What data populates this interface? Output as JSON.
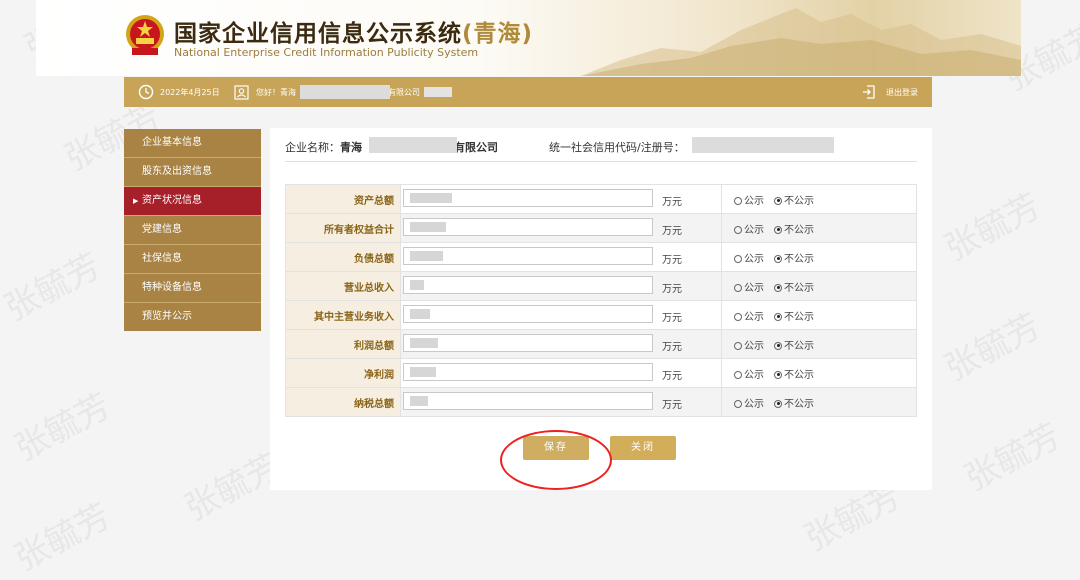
{
  "header": {
    "title_cn": "国家企业信用信息公示系统",
    "title_province": "(青海)",
    "title_en": "National Enterprise Credit Information Publicity System",
    "emblem_icon": "national-emblem-icon"
  },
  "topbar": {
    "date": "2022年4月25日",
    "greeting_prefix": "您好！青海",
    "greeting_suffix": "有限公司",
    "logout": "退出登录"
  },
  "sidebar": {
    "items": [
      {
        "label": "企业基本信息"
      },
      {
        "label": "股东及出资信息"
      },
      {
        "label": "资产状况信息"
      },
      {
        "label": "党建信息"
      },
      {
        "label": "社保信息"
      },
      {
        "label": "特种设备信息"
      },
      {
        "label": "预览并公示"
      }
    ],
    "active_index": 2
  },
  "company": {
    "name_label": "企业名称：",
    "name_prefix": "青海",
    "name_suffix": "有限公司",
    "code_label": "统一社会信用代码/注册号："
  },
  "finance": {
    "unit": "万元",
    "public_label": "公示",
    "private_label": "不公示",
    "rows": [
      {
        "label": "资产总额"
      },
      {
        "label": "所有者权益合计"
      },
      {
        "label": "负债总额"
      },
      {
        "label": "营业总收入"
      },
      {
        "label": "其中主营业务收入"
      },
      {
        "label": "利润总额"
      },
      {
        "label": "净利润"
      },
      {
        "label": "纳税总额"
      }
    ],
    "selected_option": "不公示"
  },
  "buttons": {
    "save": "保存",
    "close": "关闭"
  },
  "watermark": "张毓芳",
  "colors": {
    "gold": "#c7a458",
    "sidebar": "#a88343",
    "active": "#a6202a",
    "annotation_circle": "#e22222"
  }
}
